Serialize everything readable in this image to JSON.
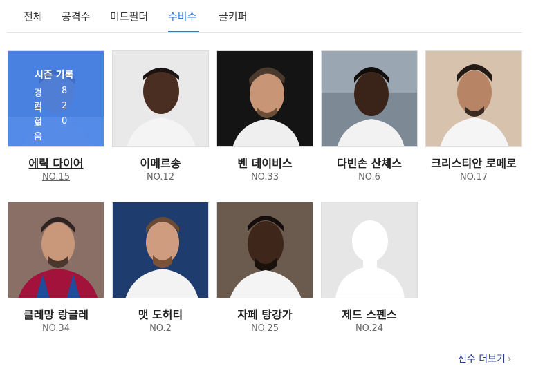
{
  "tabs": [
    {
      "label": "전체",
      "active": false
    },
    {
      "label": "공격수",
      "active": false
    },
    {
      "label": "미드필더",
      "active": false
    },
    {
      "label": "수비수",
      "active": true
    },
    {
      "label": "골키퍼",
      "active": false
    }
  ],
  "season_overlay": {
    "title": "시즌 기록",
    "rows": [
      {
        "key": "경기",
        "value": "8"
      },
      {
        "key": "득점",
        "value": "2"
      },
      {
        "key": "도움",
        "value": "0"
      }
    ]
  },
  "players": [
    {
      "name": "에릭 다이어",
      "number": "NO.15"
    },
    {
      "name": "이메르송",
      "number": "NO.12"
    },
    {
      "name": "벤 데이비스",
      "number": "NO.33"
    },
    {
      "name": "다빈손 산체스",
      "number": "NO.6"
    },
    {
      "name": "크리스티안 로메로",
      "number": "NO.17"
    },
    {
      "name": "클레망 랑글레",
      "number": "NO.34"
    },
    {
      "name": "맷 도허티",
      "number": "NO.2"
    },
    {
      "name": "자페 탕강가",
      "number": "NO.25"
    },
    {
      "name": "제드 스펜스",
      "number": "NO.24"
    }
  ],
  "more_link": {
    "label": "선수 더보기",
    "chevron": "›"
  },
  "colors": {
    "accent": "#2a7ae4",
    "overlay": "#2a6ee6",
    "more_link": "#2a3d8f"
  }
}
